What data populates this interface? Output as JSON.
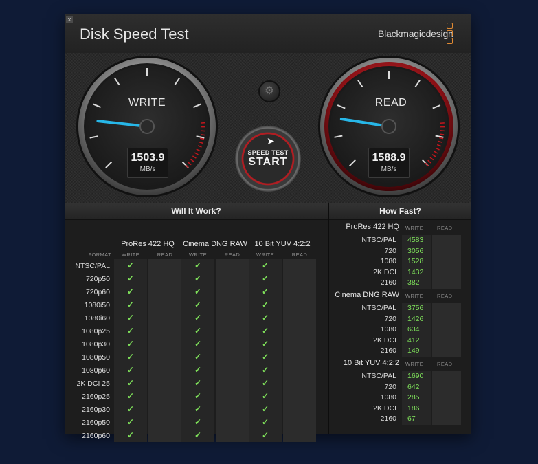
{
  "window": {
    "title": "Disk Speed Test",
    "brand": "Blackmagicdesign",
    "close_label": "x"
  },
  "gauges": {
    "write": {
      "label": "WRITE",
      "value": "1503.9",
      "unit": "MB/s",
      "needle_fraction": 0.19
    },
    "read": {
      "label": "READ",
      "value": "1588.9",
      "unit": "MB/s",
      "needle_fraction": 0.2
    }
  },
  "start_button": {
    "small": "SPEED TEST",
    "big": "START"
  },
  "will_it_work": {
    "title": "Will It Work?",
    "format_header": "FORMAT",
    "write_header": "WRITE",
    "read_header": "READ",
    "columns": [
      "ProRes 422 HQ",
      "Cinema DNG RAW",
      "10 Bit YUV 4:2:2"
    ],
    "rows": [
      "NTSC/PAL",
      "720p50",
      "720p60",
      "1080i50",
      "1080i60",
      "1080p25",
      "1080p30",
      "1080p50",
      "1080p60",
      "2K DCI 25",
      "2160p25",
      "2160p30",
      "2160p50",
      "2160p60"
    ],
    "check": "✓",
    "write_ok": true,
    "read_ok": false
  },
  "how_fast": {
    "title": "How Fast?",
    "write_header": "WRITE",
    "read_header": "READ",
    "groups": [
      {
        "name": "ProRes 422 HQ",
        "rows": [
          {
            "label": "NTSC/PAL",
            "write": "4583"
          },
          {
            "label": "720",
            "write": "3056"
          },
          {
            "label": "1080",
            "write": "1528"
          },
          {
            "label": "2K DCI",
            "write": "1432"
          },
          {
            "label": "2160",
            "write": "382"
          }
        ]
      },
      {
        "name": "Cinema DNG RAW",
        "rows": [
          {
            "label": "NTSC/PAL",
            "write": "3756"
          },
          {
            "label": "720",
            "write": "1426"
          },
          {
            "label": "1080",
            "write": "634"
          },
          {
            "label": "2K DCI",
            "write": "412"
          },
          {
            "label": "2160",
            "write": "149"
          }
        ]
      },
      {
        "name": "10 Bit YUV 4:2:2",
        "rows": [
          {
            "label": "NTSC/PAL",
            "write": "1690"
          },
          {
            "label": "720",
            "write": "642"
          },
          {
            "label": "1080",
            "write": "285"
          },
          {
            "label": "2K DCI",
            "write": "186"
          },
          {
            "label": "2160",
            "write": "67"
          }
        ]
      }
    ]
  },
  "colors": {
    "accent_read": "#c4161c",
    "needle": "#27b7e8",
    "ok_green": "#7ee05a",
    "brand_orange": "#e08a33"
  }
}
